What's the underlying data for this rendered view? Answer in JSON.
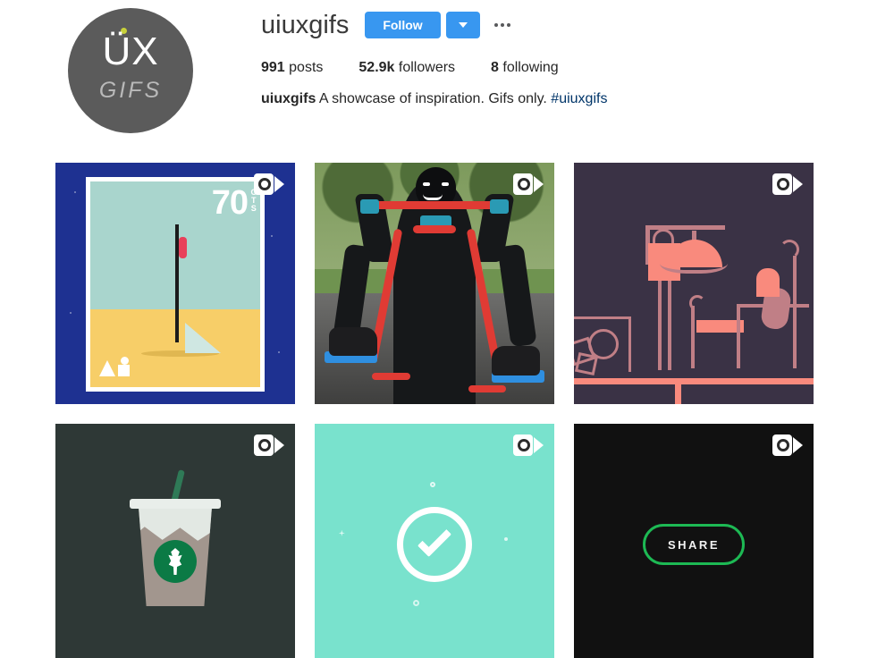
{
  "profile": {
    "username": "uiuxgifs",
    "avatar": {
      "primary_text": "ÜX",
      "secondary_text": "GIFS",
      "background_color": "#5b5b5b",
      "dot_color": "#c8d13a"
    },
    "follow_button": {
      "label": "Follow",
      "background_color": "#3897f0",
      "text_color": "#ffffff"
    },
    "dropdown_button": {
      "icon": "chevron-down-icon"
    },
    "more_button": {
      "icon": "ellipsis-icon",
      "label": "•••"
    },
    "stats": [
      {
        "key": "posts",
        "value": "991",
        "label": "posts"
      },
      {
        "key": "followers",
        "value": "52.9k",
        "label": "followers"
      },
      {
        "key": "following",
        "value": "8",
        "label": "following"
      }
    ],
    "bio": {
      "name": "uiuxgifs",
      "text": "A showcase of inspiration. Gifs only.",
      "hashtag": "#uiuxgifs",
      "hashtag_color": "#003569"
    }
  },
  "grid": {
    "badge_icon": "video-camera-icon",
    "posts": [
      {
        "id": "post-1",
        "alt": "postage stamp illustration with sailboat",
        "is_video": true,
        "background_color": "#1e3191",
        "stamp": {
          "price": "70",
          "currency": "CTS",
          "sky_color": "#a9d5cd",
          "sand_color": "#f7ce68"
        }
      },
      {
        "id": "post-2",
        "alt": "cyclist photo with red and black cartoon overlay",
        "is_video": true,
        "background_color": "#4a4a49",
        "accent_color": "#e03b34"
      },
      {
        "id": "post-3",
        "alt": "dark purple line-art interior with lamp",
        "is_video": true,
        "background_color": "#3a3245",
        "accent_color": "#f98a7d"
      },
      {
        "id": "post-4",
        "alt": "iced Starbucks coffee cup illustration",
        "is_video": true,
        "background_color": "#2e3836",
        "accent_color": "#0b7a45"
      },
      {
        "id": "post-5",
        "alt": "white checkmark in circle on mint background",
        "is_video": true,
        "background_color": "#79e2cd",
        "accent_color": "#ffffff"
      },
      {
        "id": "post-6",
        "alt": "green outlined SHARE button on black",
        "is_video": true,
        "background_color": "#111111",
        "accent_color": "#1db954",
        "button_label": "SHARE"
      }
    ]
  }
}
